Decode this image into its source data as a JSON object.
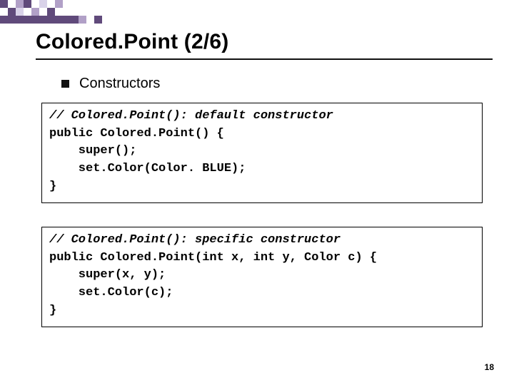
{
  "title": "Colored.Point (2/6)",
  "bullet": "Constructors",
  "code1": {
    "l1": "// Colored.Point(): default constructor",
    "l2": "public Colored.Point() {",
    "l3": "    super();",
    "l4": "    set.Color(Color. BLUE);",
    "l5": "}"
  },
  "code2": {
    "l1": "// Colored.Point(): specific constructor",
    "l2": "public Colored.Point(int x, int y, Color c) {",
    "l3": "    super(x, y);",
    "l4": "    set.Color(c);",
    "l5": "}"
  },
  "page_number": "18",
  "deco_colors": {
    "dark": "#604a7b",
    "light": "#b1a0c7",
    "pale": "#d9d2e9"
  }
}
